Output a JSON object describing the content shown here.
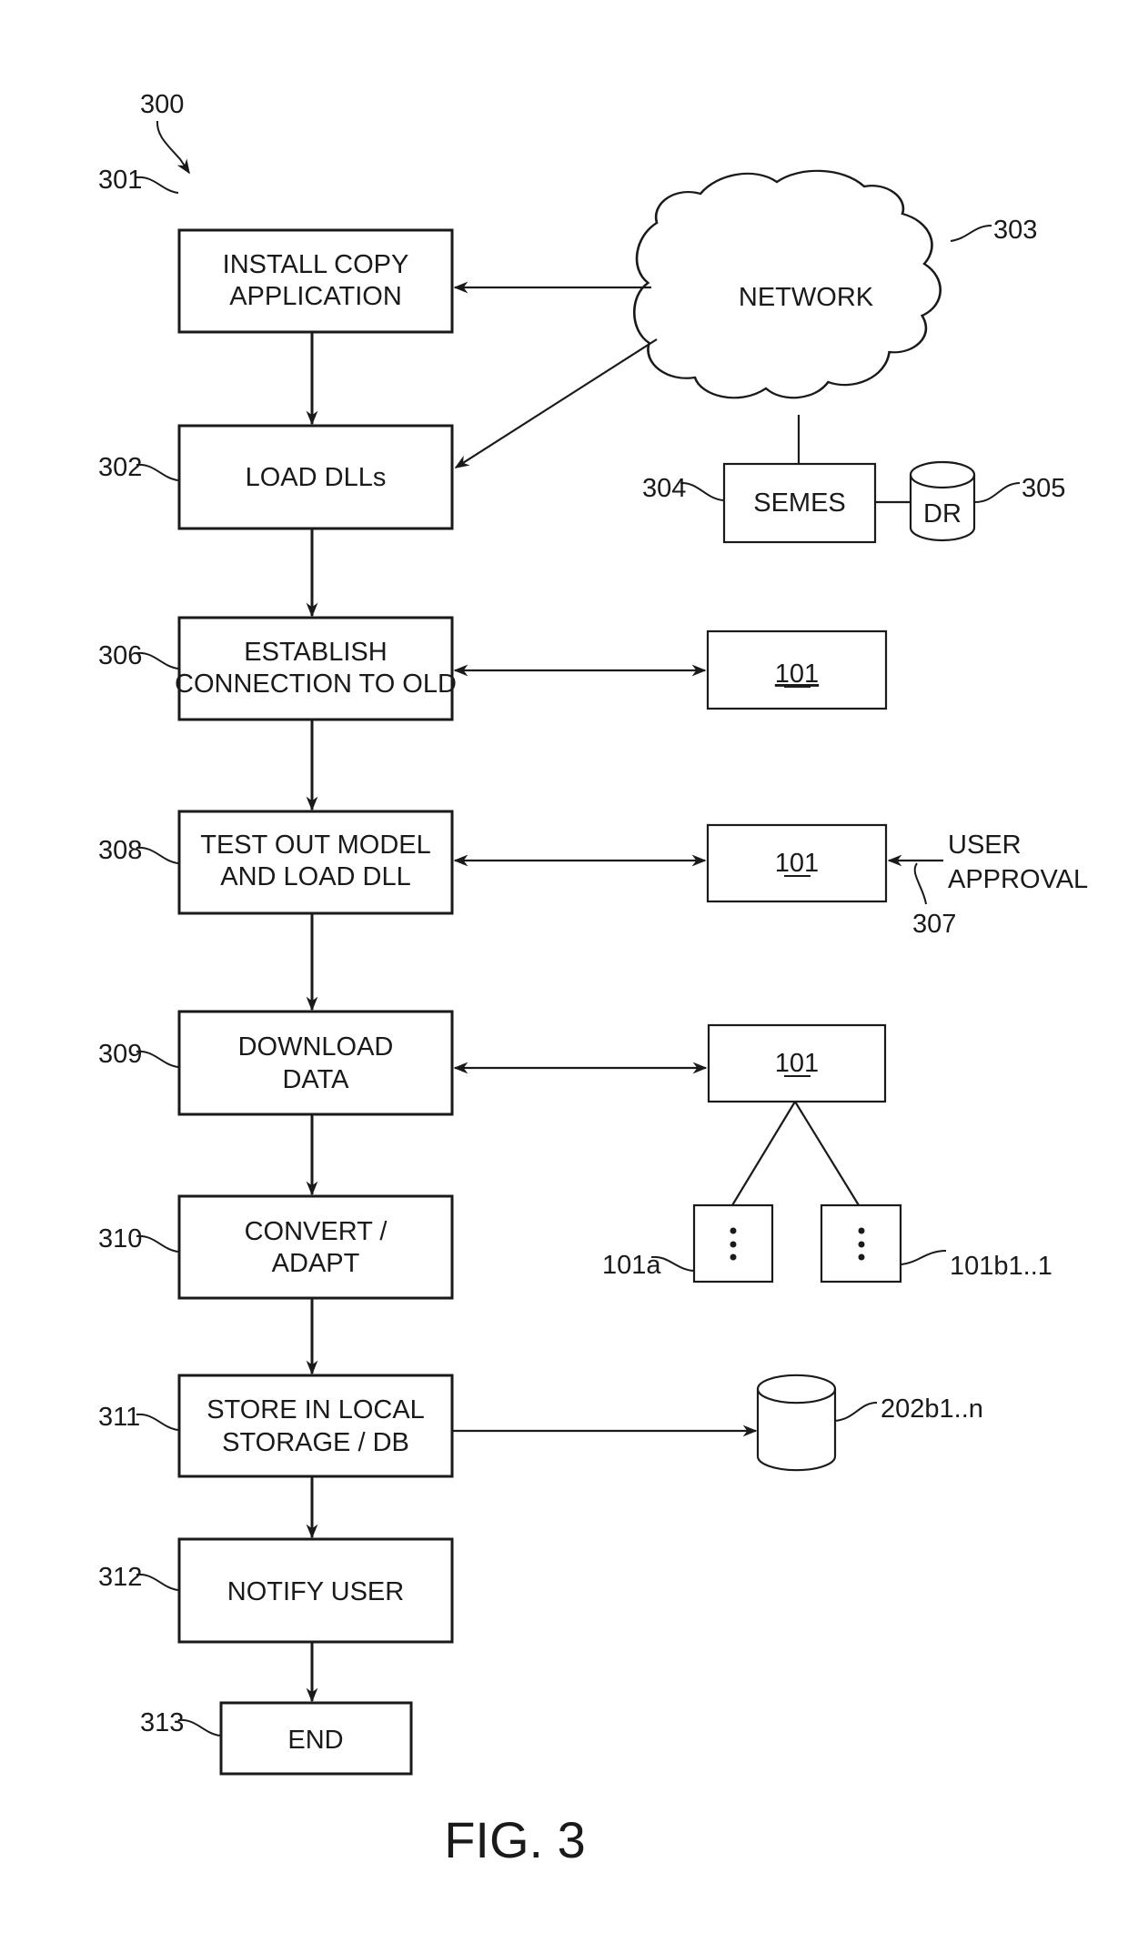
{
  "figure": {
    "number_label": "300",
    "caption": "FIG. 3"
  },
  "steps": [
    {
      "ref": "301",
      "lines": [
        "INSTALL COPY",
        "APPLICATION"
      ]
    },
    {
      "ref": "302",
      "lines": [
        "LOAD DLLs"
      ]
    },
    {
      "ref": "306",
      "lines": [
        "ESTABLISH",
        "CONNECTION TO OLD"
      ]
    },
    {
      "ref": "308",
      "lines": [
        "TEST OUT MODEL",
        "AND LOAD DLL"
      ]
    },
    {
      "ref": "309",
      "lines": [
        "DOWNLOAD",
        "DATA"
      ]
    },
    {
      "ref": "310",
      "lines": [
        "CONVERT /",
        "ADAPT"
      ]
    },
    {
      "ref": "311",
      "lines": [
        "STORE IN LOCAL",
        "STORAGE / DB"
      ]
    },
    {
      "ref": "312",
      "lines": [
        "NOTIFY USER"
      ]
    },
    {
      "ref": "313",
      "lines": [
        "END"
      ]
    }
  ],
  "network": {
    "ref": "303",
    "label": "NETWORK"
  },
  "server": {
    "ref": "304",
    "label": "SEMES"
  },
  "repository": {
    "ref": "305",
    "label": "DR"
  },
  "device_boxes": [
    {
      "label": "101",
      "connects_to": "306"
    },
    {
      "label": "101",
      "connects_to": "308"
    },
    {
      "label": "101",
      "connects_to": "309"
    }
  ],
  "user_approval": {
    "ref": "307",
    "lines": [
      "USER",
      "APPROVAL"
    ]
  },
  "sub_modules": [
    {
      "ref": "101a",
      "content": "⋮"
    },
    {
      "ref": "101b1..1",
      "content": "⋮"
    }
  ],
  "local_db": {
    "ref": "202b1..n"
  }
}
